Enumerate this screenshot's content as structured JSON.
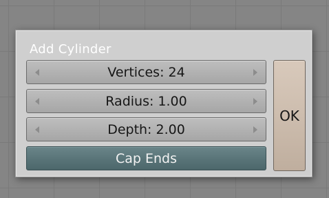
{
  "dialog": {
    "title": "Add Cylinder",
    "fields": [
      {
        "label": "Vertices: 24"
      },
      {
        "label": "Radius: 1.00"
      },
      {
        "label": "Depth: 2.00"
      }
    ],
    "toggle_label": "Cap Ends",
    "ok_label": "OK"
  },
  "colors": {
    "background": "#858585",
    "panel": "#cfcfcf",
    "field": "#b2b2b2",
    "toggle_active": "#5a7579",
    "ok_button": "#cdbdae"
  },
  "icons": {
    "decrement": "triangle-left-icon",
    "increment": "triangle-right-icon"
  }
}
